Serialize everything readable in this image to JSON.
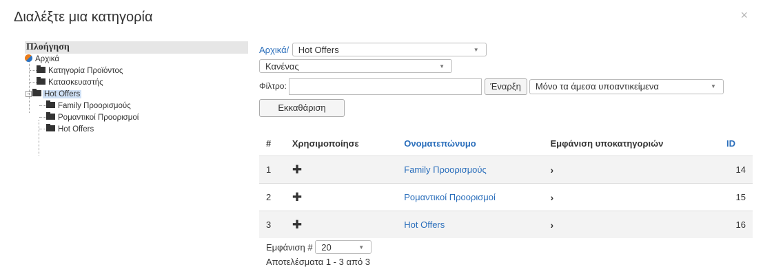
{
  "dialog": {
    "title": "Διαλέξτε μια κατηγορία",
    "close": "×"
  },
  "tree": {
    "header": "Πλοήγηση",
    "nodes": [
      {
        "label": "Αρχικά"
      },
      {
        "label": "Κατηγορία Προϊόντος"
      },
      {
        "label": "Κατασκευαστής"
      },
      {
        "label": "Hot Offers"
      },
      {
        "label": "Family Προορισμούς"
      },
      {
        "label": "Ρομαντικοί Προορισμοί"
      },
      {
        "label": "Hot Offers"
      }
    ]
  },
  "browse": {
    "breadcrumb_home": "Αρχικά/",
    "category_select": "Hot Offers",
    "none_select": "Κανένας",
    "filter_label": "Φίλτρο:",
    "filter_value": "",
    "start_button": "Έναρξη",
    "scope_select": "Μόνο τα άμεσα υποαντικείμενα",
    "clear_button": "Εκκαθάριση"
  },
  "table": {
    "headers": [
      "#",
      "Χρησιμοποίησε",
      "Ονοματεπώνυμο",
      "Εμφάνιση υποκατηγοριών",
      "ID"
    ],
    "rows": [
      {
        "num": "1",
        "name": "Family Προορισμούς",
        "id": "14"
      },
      {
        "num": "2",
        "name": "Ρομαντικοί Προορισμοί",
        "id": "15"
      },
      {
        "num": "3",
        "name": "Hot Offers",
        "id": "16"
      }
    ]
  },
  "footer": {
    "show_label": "Εμφάνιση #",
    "page_size": "20",
    "results": "Αποτελέσματα 1 - 3 από 3"
  },
  "icons": {
    "use": "plus-icon",
    "subcats": "chevron-right-icon"
  },
  "colors": {
    "link": "#2a6ebb",
    "selected_bg": "#cfe0f5"
  }
}
